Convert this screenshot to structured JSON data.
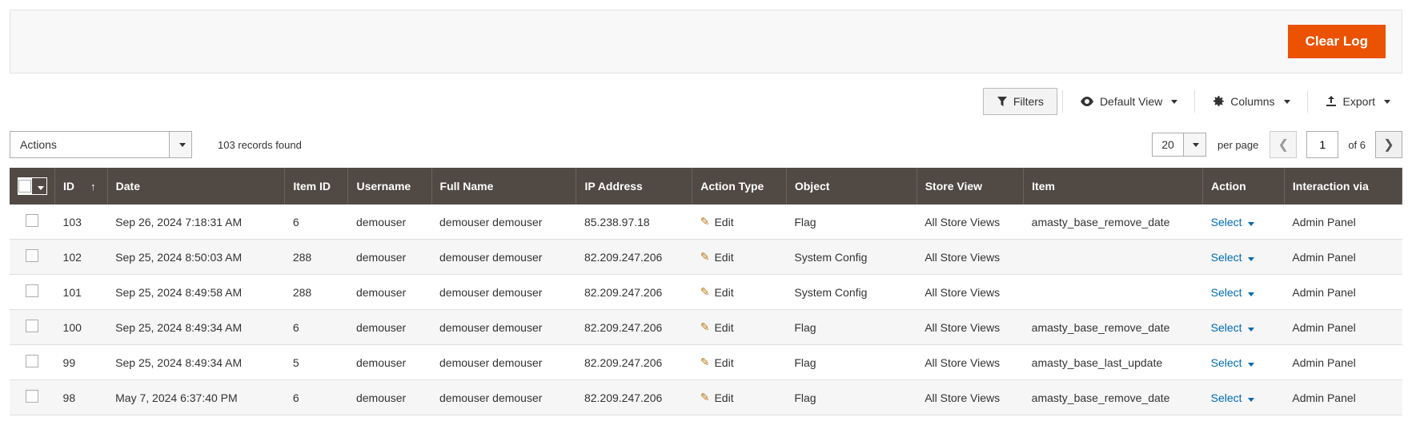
{
  "header": {
    "clear_log": "Clear Log"
  },
  "toolbar": {
    "filters": "Filters",
    "default_view": "Default View",
    "columns": "Columns",
    "export": "Export"
  },
  "actions": {
    "label": "Actions",
    "records_found": "103 records found"
  },
  "pagination": {
    "page_size": "20",
    "per_page_label": "per page",
    "current_page": "1",
    "of_label": "of 6"
  },
  "columns": {
    "id": "ID",
    "date": "Date",
    "item_id": "Item ID",
    "username": "Username",
    "full_name": "Full Name",
    "ip": "IP Address",
    "action_type": "Action Type",
    "object": "Object",
    "store_view": "Store View",
    "item": "Item",
    "action": "Action",
    "interaction": "Interaction via"
  },
  "labels": {
    "edit": "Edit",
    "select": "Select"
  },
  "rows": [
    {
      "id": "103",
      "date": "Sep 26, 2024 7:18:31 AM",
      "item_id": "6",
      "username": "demouser",
      "full_name": "demouser demouser",
      "ip": "85.238.97.18",
      "action_type": "Edit",
      "object": "Flag",
      "store_view": "All Store Views",
      "item": "amasty_base_remove_date",
      "interaction": "Admin Panel"
    },
    {
      "id": "102",
      "date": "Sep 25, 2024 8:50:03 AM",
      "item_id": "288",
      "username": "demouser",
      "full_name": "demouser demouser",
      "ip": "82.209.247.206",
      "action_type": "Edit",
      "object": "System Config",
      "store_view": "All Store Views",
      "item": "",
      "interaction": "Admin Panel"
    },
    {
      "id": "101",
      "date": "Sep 25, 2024 8:49:58 AM",
      "item_id": "288",
      "username": "demouser",
      "full_name": "demouser demouser",
      "ip": "82.209.247.206",
      "action_type": "Edit",
      "object": "System Config",
      "store_view": "All Store Views",
      "item": "",
      "interaction": "Admin Panel"
    },
    {
      "id": "100",
      "date": "Sep 25, 2024 8:49:34 AM",
      "item_id": "6",
      "username": "demouser",
      "full_name": "demouser demouser",
      "ip": "82.209.247.206",
      "action_type": "Edit",
      "object": "Flag",
      "store_view": "All Store Views",
      "item": "amasty_base_remove_date",
      "interaction": "Admin Panel"
    },
    {
      "id": "99",
      "date": "Sep 25, 2024 8:49:34 AM",
      "item_id": "5",
      "username": "demouser",
      "full_name": "demouser demouser",
      "ip": "82.209.247.206",
      "action_type": "Edit",
      "object": "Flag",
      "store_view": "All Store Views",
      "item": "amasty_base_last_update",
      "interaction": "Admin Panel"
    },
    {
      "id": "98",
      "date": "May 7, 2024 6:37:40 PM",
      "item_id": "6",
      "username": "demouser",
      "full_name": "demouser demouser",
      "ip": "82.209.247.206",
      "action_type": "Edit",
      "object": "Flag",
      "store_view": "All Store Views",
      "item": "amasty_base_remove_date",
      "interaction": "Admin Panel"
    }
  ]
}
